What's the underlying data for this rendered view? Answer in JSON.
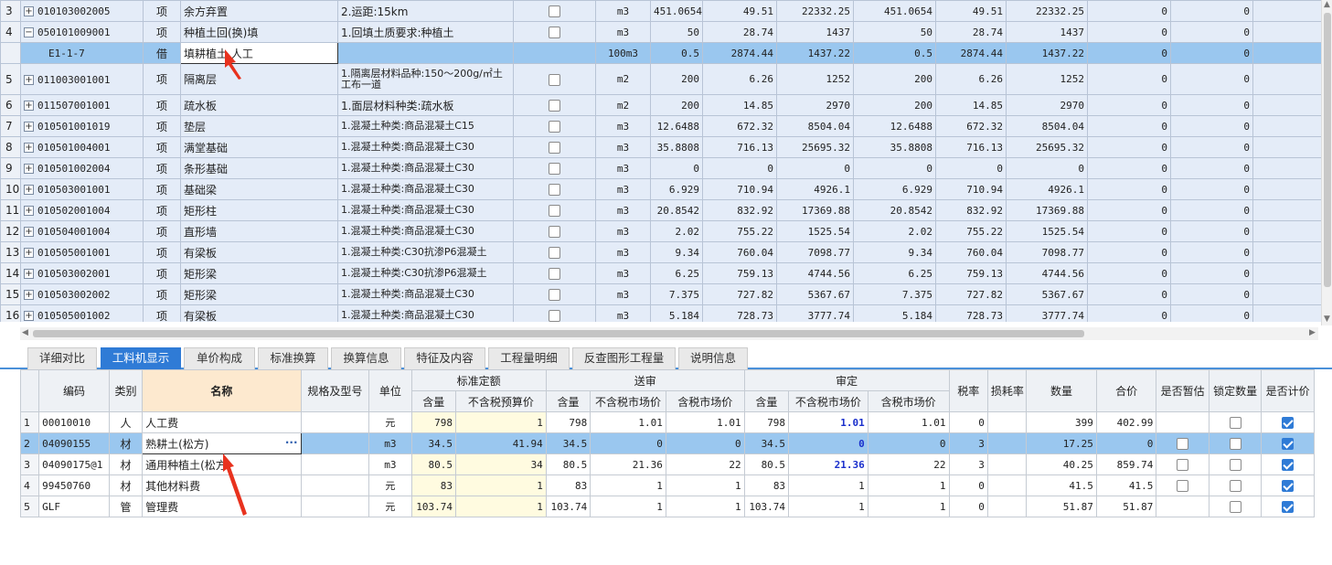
{
  "top_rows": [
    {
      "rn": "3",
      "exp": "+",
      "code": "010103002005",
      "type": "项",
      "name": "余方弃置",
      "feature": "2.运距:15km",
      "unit": "m3",
      "q1": "451.0654",
      "p1": "49.51",
      "t1": "22332.25",
      "q2": "451.0654",
      "p2": "49.51",
      "t2": "22332.25",
      "z1": "0",
      "z2": "0"
    },
    {
      "rn": "4",
      "exp": "−",
      "code": "050101009001",
      "type": "项",
      "name": "种植土回(换)填",
      "feature": "1.回填土质要求:种植土",
      "unit": "m3",
      "q1": "50",
      "p1": "28.74",
      "t1": "1437",
      "q2": "50",
      "p2": "28.74",
      "t2": "1437",
      "z1": "0",
      "z2": "0"
    },
    {
      "rn": "",
      "exp": "",
      "code": "E1-1-7",
      "type": "借",
      "name": "填耕植土 人工",
      "feature": "",
      "unit": "100m3",
      "q1": "0.5",
      "p1": "2874.44",
      "t1": "1437.22",
      "q2": "0.5",
      "p2": "2874.44",
      "t2": "1437.22",
      "z1": "0",
      "z2": "0",
      "selected": true
    },
    {
      "rn": "5",
      "exp": "+",
      "code": "011003001001",
      "type": "项",
      "name": "隔离层",
      "feature": "1.隔离层材料品种:150～200g/㎡土工布一道",
      "unit": "m2",
      "q1": "200",
      "p1": "6.26",
      "t1": "1252",
      "q2": "200",
      "p2": "6.26",
      "t2": "1252",
      "z1": "0",
      "z2": "0"
    },
    {
      "rn": "6",
      "exp": "+",
      "code": "011507001001",
      "type": "项",
      "name": "疏水板",
      "feature": "1.面层材料种类:疏水板",
      "unit": "m2",
      "q1": "200",
      "p1": "14.85",
      "t1": "2970",
      "q2": "200",
      "p2": "14.85",
      "t2": "2970",
      "z1": "0",
      "z2": "0"
    },
    {
      "rn": "7",
      "exp": "+",
      "code": "010501001019",
      "type": "项",
      "name": "垫层",
      "feature": "1.混凝土种类:商品混凝土C15",
      "unit": "m3",
      "q1": "12.6488",
      "p1": "672.32",
      "t1": "8504.04",
      "q2": "12.6488",
      "p2": "672.32",
      "t2": "8504.04",
      "z1": "0",
      "z2": "0"
    },
    {
      "rn": "8",
      "exp": "+",
      "code": "010501004001",
      "type": "项",
      "name": "满堂基础",
      "feature": "1.混凝土种类:商品混凝土C30",
      "unit": "m3",
      "q1": "35.8808",
      "p1": "716.13",
      "t1": "25695.32",
      "q2": "35.8808",
      "p2": "716.13",
      "t2": "25695.32",
      "z1": "0",
      "z2": "0"
    },
    {
      "rn": "9",
      "exp": "+",
      "code": "010501002004",
      "type": "项",
      "name": "条形基础",
      "feature": "1.混凝土种类:商品混凝土C30",
      "unit": "m3",
      "q1": "0",
      "p1": "0",
      "t1": "0",
      "q2": "0",
      "p2": "0",
      "t2": "0",
      "z1": "0",
      "z2": "0"
    },
    {
      "rn": "10",
      "exp": "+",
      "code": "010503001001",
      "type": "项",
      "name": "基础梁",
      "feature": "1.混凝土种类:商品混凝土C30",
      "unit": "m3",
      "q1": "6.929",
      "p1": "710.94",
      "t1": "4926.1",
      "q2": "6.929",
      "p2": "710.94",
      "t2": "4926.1",
      "z1": "0",
      "z2": "0"
    },
    {
      "rn": "11",
      "exp": "+",
      "code": "010502001004",
      "type": "项",
      "name": "矩形柱",
      "feature": "1.混凝土种类:商品混凝土C30",
      "unit": "m3",
      "q1": "20.8542",
      "p1": "832.92",
      "t1": "17369.88",
      "q2": "20.8542",
      "p2": "832.92",
      "t2": "17369.88",
      "z1": "0",
      "z2": "0"
    },
    {
      "rn": "12",
      "exp": "+",
      "code": "010504001004",
      "type": "项",
      "name": "直形墙",
      "feature": "1.混凝土种类:商品混凝土C30",
      "unit": "m3",
      "q1": "2.02",
      "p1": "755.22",
      "t1": "1525.54",
      "q2": "2.02",
      "p2": "755.22",
      "t2": "1525.54",
      "z1": "0",
      "z2": "0"
    },
    {
      "rn": "13",
      "exp": "+",
      "code": "010505001001",
      "type": "项",
      "name": "有梁板",
      "feature": "1.混凝土种类:C30抗渗P6混凝土",
      "unit": "m3",
      "q1": "9.34",
      "p1": "760.04",
      "t1": "7098.77",
      "q2": "9.34",
      "p2": "760.04",
      "t2": "7098.77",
      "z1": "0",
      "z2": "0"
    },
    {
      "rn": "14",
      "exp": "+",
      "code": "010503002001",
      "type": "项",
      "name": "矩形梁",
      "feature": "1.混凝土种类:C30抗渗P6混凝土",
      "unit": "m3",
      "q1": "6.25",
      "p1": "759.13",
      "t1": "4744.56",
      "q2": "6.25",
      "p2": "759.13",
      "t2": "4744.56",
      "z1": "0",
      "z2": "0"
    },
    {
      "rn": "15",
      "exp": "+",
      "code": "010503002002",
      "type": "项",
      "name": "矩形梁",
      "feature": "1.混凝土种类:商品混凝土C30",
      "unit": "m3",
      "q1": "7.375",
      "p1": "727.82",
      "t1": "5367.67",
      "q2": "7.375",
      "p2": "727.82",
      "t2": "5367.67",
      "z1": "0",
      "z2": "0"
    },
    {
      "rn": "16",
      "exp": "+",
      "code": "010505001002",
      "type": "项",
      "name": "有梁板",
      "feature": "1.混凝土种类:商品混凝土C30",
      "unit": "m3",
      "q1": "5.184",
      "p1": "728.73",
      "t1": "3777.74",
      "q2": "5.184",
      "p2": "728.73",
      "t2": "3777.74",
      "z1": "0",
      "z2": "0"
    }
  ],
  "tabs": [
    "详细对比",
    "工料机显示",
    "单价构成",
    "标准换算",
    "换算信息",
    "特征及内容",
    "工程量明细",
    "反查图形工程量",
    "说明信息"
  ],
  "active_tab": "工料机显示",
  "bottom_headers": {
    "code": "编码",
    "cat": "类别",
    "name": "名称",
    "spec": "规格及型号",
    "unit": "单位",
    "g1": "标准定额",
    "g2": "送审",
    "g3": "审定",
    "g1a": "含量",
    "g1b": "不含税预算价",
    "g2a": "含量",
    "g2b": "不含税市场价",
    "g2c": "含税市场价",
    "g3a": "含量",
    "g3b": "不含税市场价",
    "g3c": "含税市场价",
    "tax": "税率",
    "loss": "损耗率",
    "qty": "数量",
    "total": "合价",
    "temp": "是否暂估",
    "lock": "锁定数量",
    "price": "是否计价"
  },
  "bottom_rows": [
    {
      "rn": "1",
      "code": "00010010",
      "cat": "人",
      "name": "人工费",
      "spec": "",
      "unit": "元",
      "a1": "798",
      "b1": "1",
      "a2": "798",
      "b2": "1.01",
      "c2": "1.01",
      "a3": "798",
      "b3": "1.01",
      "c3": "1.01",
      "tax": "0",
      "loss": "",
      "qty": "399",
      "total": "402.99",
      "temp": false,
      "show_temp": false,
      "lock": false,
      "price": true
    },
    {
      "rn": "2",
      "code": "04090155",
      "cat": "材",
      "name": "熟耕土(松方)",
      "spec": "",
      "unit": "m3",
      "a1": "34.5",
      "b1": "41.94",
      "a2": "34.5",
      "b2": "0",
      "c2": "0",
      "a3": "34.5",
      "b3": "0",
      "c3": "0",
      "tax": "3",
      "loss": "",
      "qty": "17.25",
      "total": "0",
      "temp": false,
      "show_temp": true,
      "lock": false,
      "price": true,
      "selected": true
    },
    {
      "rn": "3",
      "code": "04090175@1",
      "cat": "材",
      "name": "通用种植土(松方",
      "spec": "",
      "unit": "m3",
      "a1": "80.5",
      "b1": "34",
      "a2": "80.5",
      "b2": "21.36",
      "c2": "22",
      "a3": "80.5",
      "b3": "21.36",
      "c3": "22",
      "tax": "3",
      "loss": "",
      "qty": "40.25",
      "total": "859.74",
      "temp": false,
      "show_temp": true,
      "lock": false,
      "price": true
    },
    {
      "rn": "4",
      "code": "99450760",
      "cat": "材",
      "name": "其他材料费",
      "spec": "",
      "unit": "元",
      "a1": "83",
      "b1": "1",
      "a2": "83",
      "b2": "1",
      "c2": "1",
      "a3": "83",
      "b3": "1",
      "c3": "1",
      "tax": "0",
      "loss": "",
      "qty": "41.5",
      "total": "41.5",
      "temp": false,
      "show_temp": true,
      "lock": false,
      "price": true
    },
    {
      "rn": "5",
      "code": "GLF",
      "cat": "管",
      "name": "管理费",
      "spec": "",
      "unit": "元",
      "a1": "103.74",
      "b1": "1",
      "a2": "103.74",
      "b2": "1",
      "c2": "1",
      "a3": "103.74",
      "b3": "1",
      "c3": "1",
      "tax": "0",
      "loss": "",
      "qty": "51.87",
      "total": "51.87",
      "temp": false,
      "show_temp": false,
      "lock": false,
      "price": true
    }
  ],
  "edit_button": "···",
  "colors": {
    "selected": "#9ac7ef",
    "tab_active": "#2f7bd6",
    "grid_bg": "#e4ecf8",
    "highlight_value": "#1a2fcc",
    "arrow": "#e8321e"
  }
}
